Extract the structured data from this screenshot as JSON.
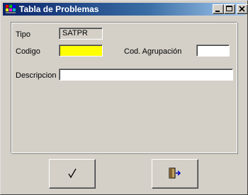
{
  "window": {
    "title": "Tabla de Problemas"
  },
  "form": {
    "tipo": {
      "label": "Tipo",
      "value": "SATPR"
    },
    "codigo": {
      "label": "Codigo",
      "value": ""
    },
    "cod_agrupacion": {
      "label": "Cod. Agrupación",
      "value": ""
    },
    "descripcion": {
      "label": "Descripcion",
      "value": ""
    }
  },
  "buttons": {
    "accept_icon": "checkmark-icon",
    "exit_icon": "exit-door-icon"
  },
  "colors": {
    "required_field": "#ffff00",
    "titlebar_start": "#0a246a",
    "titlebar_end": "#a6caf0",
    "face": "#d4d0c8"
  }
}
